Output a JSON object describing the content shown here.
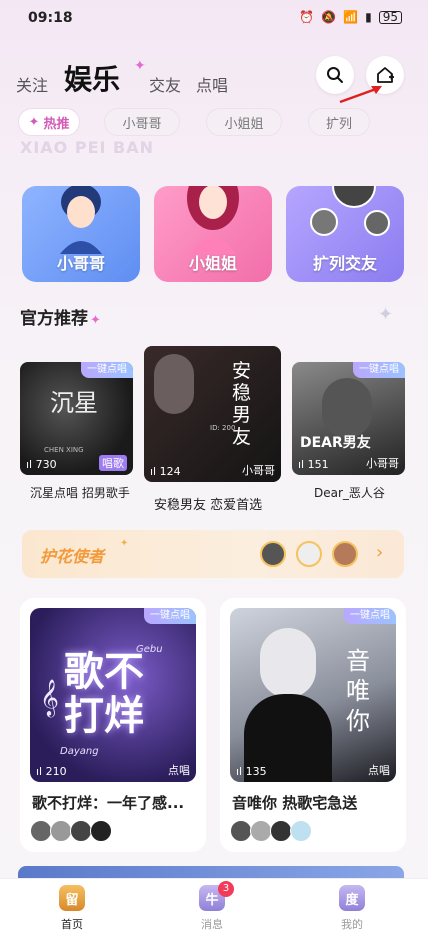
{
  "status": {
    "time": "09:18",
    "battery": "95"
  },
  "topnav": {
    "tabs": [
      "关注",
      "娱乐",
      "交友",
      "点唱"
    ],
    "active_index": 1
  },
  "chips": [
    "热推",
    "小哥哥",
    "小姐姐",
    "扩列"
  ],
  "watermark": "XIAO PEI BAN",
  "categories": [
    {
      "label": "小哥哥"
    },
    {
      "label": "小姐姐"
    },
    {
      "label": "扩列交友"
    }
  ],
  "official": {
    "title": "官方推荐"
  },
  "recommend": [
    {
      "badge": "一键点唱",
      "count": "730",
      "caption": "沉星点唱 招男歌手",
      "art_text": "沉星",
      "art_sub": "CHEN XING",
      "tag": "唱歌"
    },
    {
      "count": "124",
      "caption": "安稳男友 恋爱首选",
      "art_text": "安稳男友",
      "art_sub": "ID: 200",
      "tag": "小哥哥"
    },
    {
      "badge": "一键点唱",
      "count": "151",
      "caption": "Dear_恶人谷",
      "art_text": "DEAR男友",
      "tag": "小哥哥"
    }
  ],
  "banner": {
    "title": "护花使者"
  },
  "cards": [
    {
      "badge": "一键点唱",
      "count": "210",
      "tag": "点唱",
      "title": "歌不打烊：一年了感...",
      "art_text": "歌不打烊",
      "art_sub_top": "Gebu",
      "art_sub_bottom": "Dayang"
    },
    {
      "badge": "一键点唱",
      "count": "135",
      "tag": "点唱",
      "title": "音唯你 热歌宅急送",
      "art_text": "音唯你"
    }
  ],
  "tabbar": {
    "items": [
      {
        "label": "首页",
        "icon": "home-icon"
      },
      {
        "label": "消息",
        "icon": "message-icon",
        "badge": "3"
      },
      {
        "label": "我的",
        "icon": "profile-icon"
      }
    ]
  },
  "colors": {
    "accent": "#d45cb8",
    "banner_text": "#f39a3a",
    "notif": "#f23a5a"
  }
}
